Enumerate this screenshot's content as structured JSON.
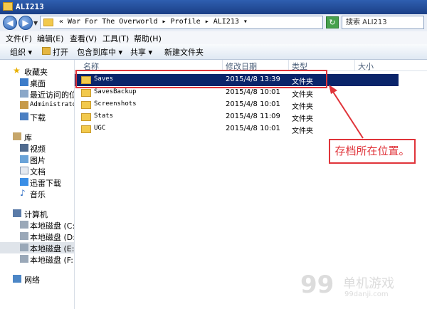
{
  "window": {
    "title": "ALI213"
  },
  "address": {
    "crumbs": "« War For The Overworld ▸ Profile ▸ ALI213 ▾",
    "search": "搜索 ALI213"
  },
  "menu": [
    "文件(F)",
    "编辑(E)",
    "查看(V)",
    "工具(T)",
    "帮助(H)"
  ],
  "toolbar": [
    "组织 ▾",
    "打开",
    "包含到库中 ▾",
    "共享 ▾",
    "新建文件夹"
  ],
  "nav": {
    "favorites": "收藏夹",
    "fav_items": [
      "桌面",
      "最近访问的位置",
      "Administrator",
      "下载"
    ],
    "library": "库",
    "lib_items": [
      "视频",
      "图片",
      "文档",
      "迅雷下载",
      "音乐"
    ],
    "computer": "计算机",
    "drives": [
      "本地磁盘 (C:)",
      "本地磁盘 (D:)",
      "本地磁盘 (E:)",
      "本地磁盘 (F:)"
    ],
    "network": "网络"
  },
  "columns": [
    "名称",
    "修改日期",
    "类型",
    "大小"
  ],
  "files": [
    {
      "name": "Saves",
      "date": "2015/4/8 13:39",
      "type": "文件夹"
    },
    {
      "name": "SavesBackup",
      "date": "2015/4/8 10:01",
      "type": "文件夹"
    },
    {
      "name": "Screenshots",
      "date": "2015/4/8 10:01",
      "type": "文件夹"
    },
    {
      "name": "Stats",
      "date": "2015/4/8 11:09",
      "type": "文件夹"
    },
    {
      "name": "UGC",
      "date": "2015/4/8 10:01",
      "type": "文件夹"
    }
  ],
  "annotation": "存档所在位置。",
  "watermark": {
    "num": "99",
    "name": "单机游戏",
    "url": "99danji.com"
  },
  "colors": {
    "accent": "#e0343a",
    "selection": "#0a246a",
    "folder": "#f2c94c"
  }
}
